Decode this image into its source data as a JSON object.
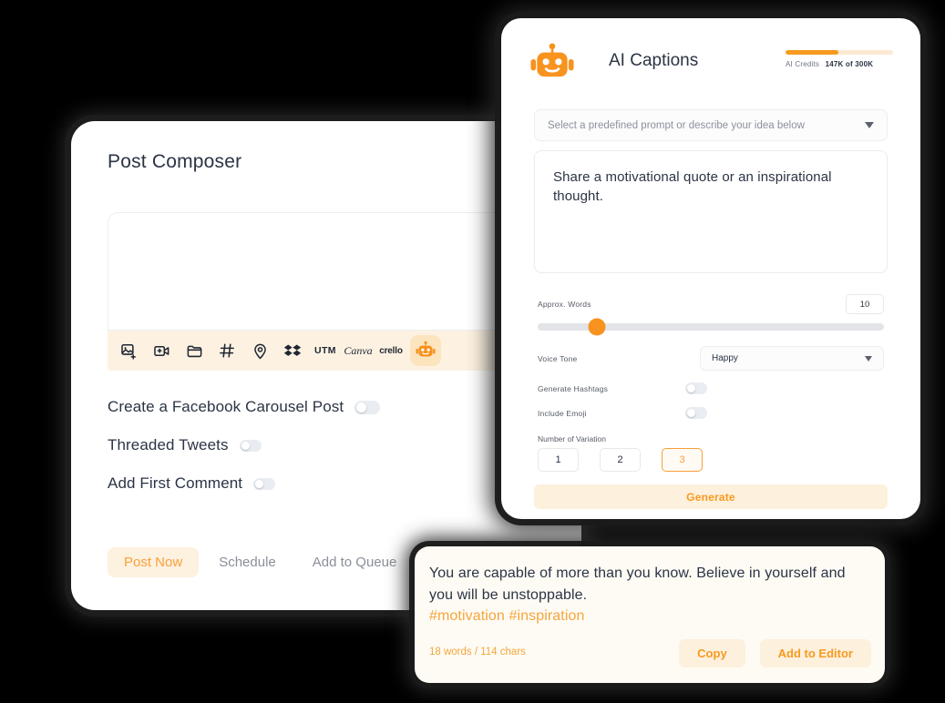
{
  "composer": {
    "title": "Post Composer",
    "toolbar": [
      {
        "icon": "add-image-icon",
        "label": ""
      },
      {
        "icon": "add-video-icon",
        "label": ""
      },
      {
        "icon": "folder-icon",
        "label": ""
      },
      {
        "icon": "hashtag-icon",
        "label": "#"
      },
      {
        "icon": "location-pin-icon",
        "label": ""
      },
      {
        "icon": "dropbox-icon",
        "label": ""
      },
      {
        "icon": "utm-icon",
        "label": "UTM"
      },
      {
        "icon": "canva-icon",
        "label": "Canva"
      },
      {
        "icon": "crello-icon",
        "label": "crello"
      },
      {
        "icon": "ai-robot-icon",
        "label": ""
      }
    ],
    "options": [
      {
        "label": "Create a Facebook Carousel Post",
        "enabled": false
      },
      {
        "label": "Threaded Tweets",
        "enabled": false
      },
      {
        "label": "Add First Comment",
        "enabled": false
      }
    ],
    "actions": [
      {
        "label": "Post Now",
        "active": true
      },
      {
        "label": "Schedule",
        "active": false
      },
      {
        "label": "Add to Queue",
        "active": false
      }
    ]
  },
  "ai_panel": {
    "title": "AI Captions",
    "logo_icon": "ai-robot-icon",
    "credits": {
      "label": "AI Credits",
      "value": "147K of 300K",
      "used": 147,
      "total": 300,
      "percent": 49
    },
    "prompt_select": {
      "placeholder": "Select a predefined prompt or describe your idea below",
      "icon": "chevron-down-icon"
    },
    "prompt_textarea": {
      "value": "Share a motivational quote or an inspirational thought."
    },
    "words": {
      "label": "Approx. Words",
      "value": "10",
      "slider_percent": 17
    },
    "tone": {
      "label": "Voice Tone",
      "value": "Happy",
      "icon": "chevron-down-icon"
    },
    "switches": [
      {
        "label": "Generate Hashtags",
        "enabled": false
      },
      {
        "label": "Include Emoji",
        "enabled": false
      }
    ],
    "variation": {
      "label": "Number of Variation",
      "options": [
        "1",
        "2",
        "3"
      ],
      "selected": "3"
    },
    "generate_label": "Generate"
  },
  "result": {
    "text": "You are capable of more than you know. Believe in yourself and you will be unstoppable.",
    "hashtags": "#motivation #inspiration",
    "meta": "18 words / 114 chars",
    "buttons": [
      {
        "label": "Copy"
      },
      {
        "label": "Add to Editor"
      }
    ]
  },
  "colors": {
    "accent": "#f79a1f",
    "accent_light": "#fdf0dd",
    "toolbar_bg": "#fdf2e2",
    "result_bg": "#fdfbf4",
    "text_dark": "#2b3445",
    "background": "#000000"
  }
}
